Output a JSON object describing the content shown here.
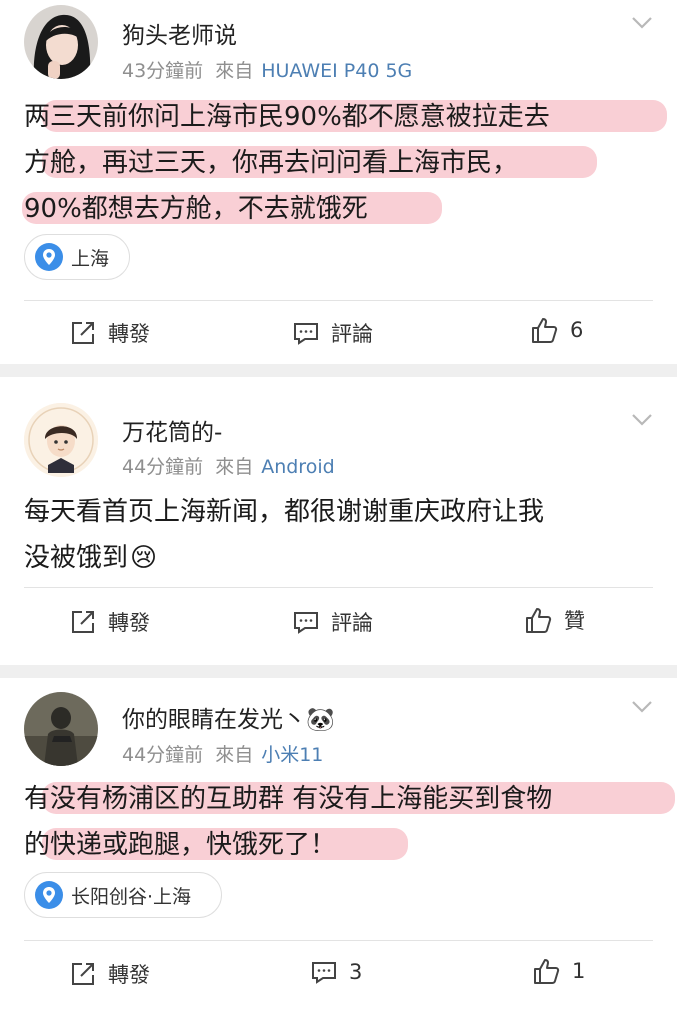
{
  "posts": [
    {
      "user": "狗头老师说",
      "time": "43分鐘前",
      "from_label": "來自",
      "source": "HUAWEI P40 5G",
      "text_lines": [
        "两三天前你问上海市民90%都不愿意被拉走去",
        "方舱，再过三天，你再去问问看上海市民，",
        "90%都想去方舱，不去就饿死"
      ],
      "location": "上海",
      "repost_label": "轉發",
      "comment_label": "評論",
      "like_label": "6"
    },
    {
      "user": "万花筒的-",
      "time": "44分鐘前",
      "from_label": "來自",
      "source": "Android",
      "text_lines": [
        "每天看首页上海新闻，都很谢谢重庆政府让我",
        "没被饿到"
      ],
      "emoji": "😢",
      "repost_label": "轉發",
      "comment_label": "評論",
      "like_label": "贊"
    },
    {
      "user": "你的眼睛在发光丶🐼",
      "time": "44分鐘前",
      "from_label": "來自",
      "source": "小米11",
      "text_lines": [
        "有没有杨浦区的互助群 有没有上海能买到食物",
        "的快递或跑腿，快饿死了！"
      ],
      "location": "长阳创谷·上海",
      "repost_label": "轉發",
      "comment_label": "3",
      "like_label": "1"
    }
  ],
  "colors": {
    "source_link": "#4d7fb3",
    "highlight": "#ee6c80",
    "location_pin": "#3b8ee8"
  },
  "icons": [
    "chevron-down-icon",
    "location-pin-icon",
    "repost-icon",
    "comment-icon",
    "like-icon"
  ]
}
